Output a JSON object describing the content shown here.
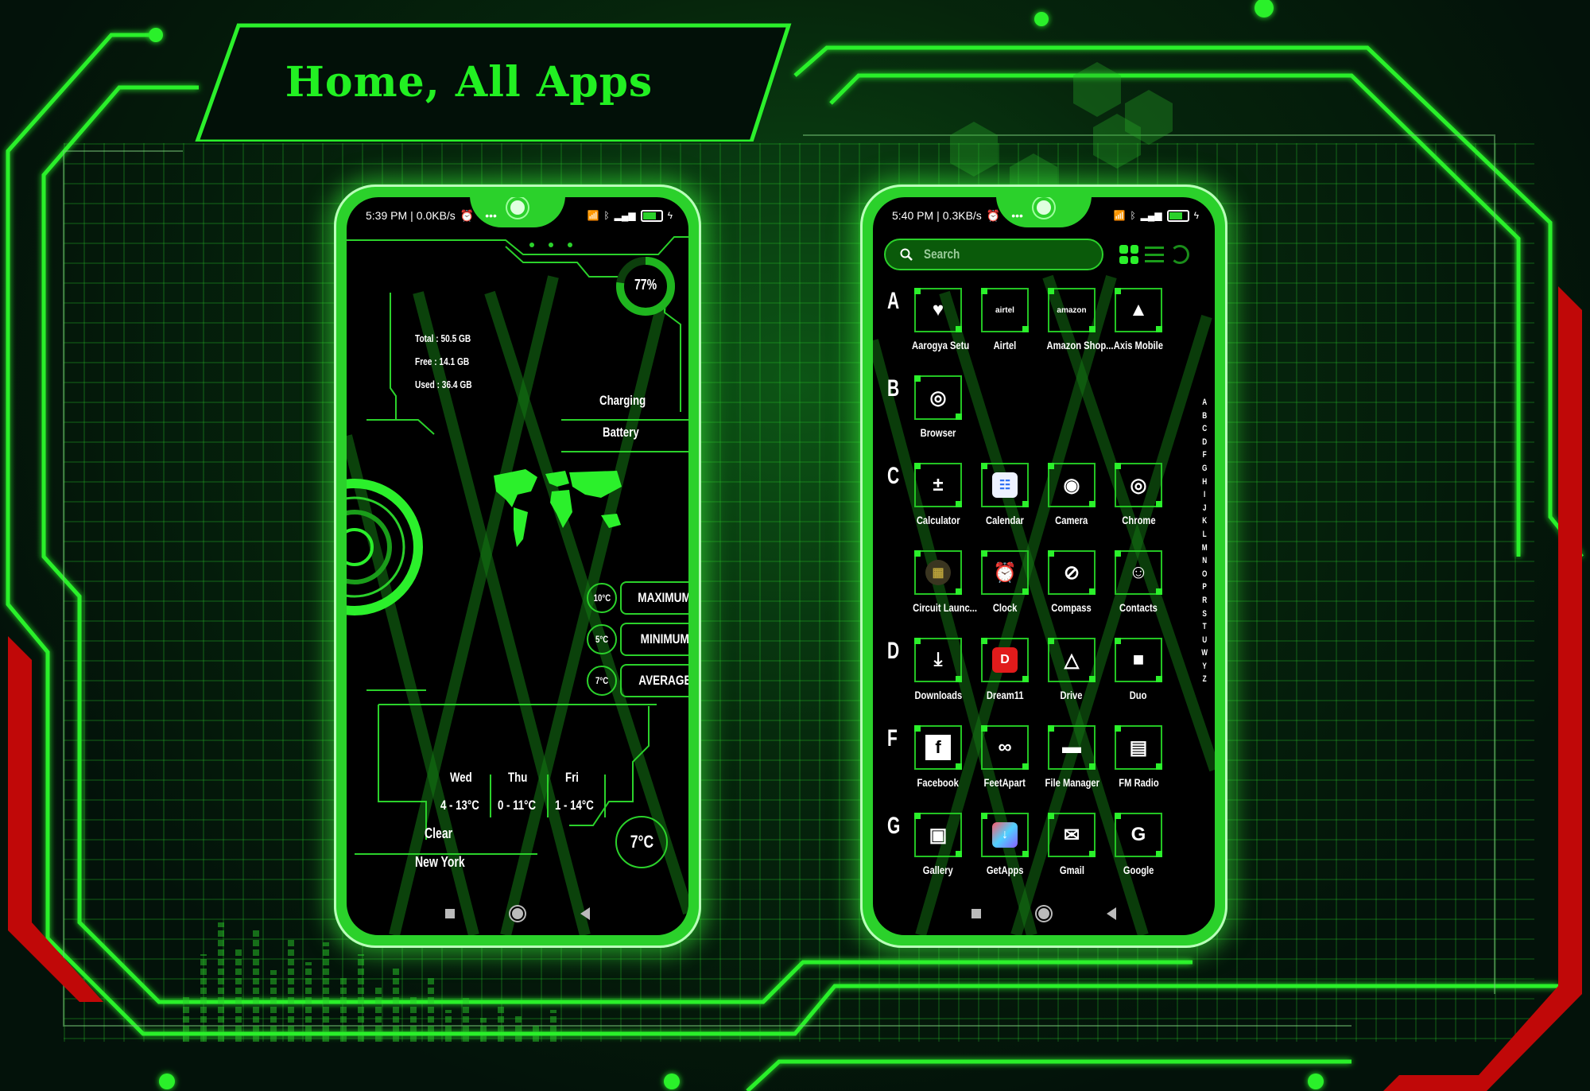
{
  "title": "Home, All Apps",
  "colors": {
    "accent": "#2bf02b",
    "background": "#03120a",
    "warning_stripe": "#d10a0a",
    "dream11_red": "#e11b1b"
  },
  "home_screen": {
    "status_bar": {
      "time": "5:39 PM",
      "net_speed": "0.0KB/s",
      "more": "•••",
      "battery": "77"
    },
    "battery_ring": {
      "percent_label": "77%",
      "value": 0.77
    },
    "storage": {
      "total": "Total : 50.5 GB",
      "free": "Free : 14.1 GB",
      "used": "Used : 36.4 GB"
    },
    "charging_label": "Charging",
    "battery_label": "Battery",
    "temps": [
      {
        "value": "10°C",
        "label": "MAXIMUM"
      },
      {
        "value": "5°C",
        "label": "MINIMUM"
      },
      {
        "value": "7°C",
        "label": "AVERAGE"
      }
    ],
    "forecast": [
      {
        "day": "Wed",
        "range": "4 - 13°C"
      },
      {
        "day": "Thu",
        "range": "0 - 11°C"
      },
      {
        "day": "Fri",
        "range": "1 - 14°C"
      }
    ],
    "condition": "Clear",
    "city": "New York",
    "current_temp": "7°C"
  },
  "drawer_screen": {
    "status_bar": {
      "time": "5:40 PM",
      "net_speed": "0.3KB/s",
      "more": "•••",
      "battery": "77"
    },
    "search_placeholder": "Search",
    "sections": [
      {
        "letter": "A",
        "apps": [
          {
            "name": "Aarogya Setu",
            "icon": "heart-check-icon",
            "glyph": "♥"
          },
          {
            "name": "Airtel",
            "icon": "airtel-icon",
            "glyph": "airtel"
          },
          {
            "name": "Amazon Shop...",
            "icon": "amazon-cart-icon",
            "glyph": "amazon"
          },
          {
            "name": "Axis Mobile",
            "icon": "axis-icon",
            "glyph": "▲"
          }
        ]
      },
      {
        "letter": "B",
        "apps": [
          {
            "name": "Browser",
            "icon": "globe-icon",
            "glyph": "◎"
          }
        ]
      },
      {
        "letter": "C",
        "apps": [
          {
            "name": "Calculator",
            "icon": "calculator-icon",
            "glyph": "±"
          },
          {
            "name": "Calendar",
            "icon": "calendar-icon",
            "glyph": "☷"
          },
          {
            "name": "Camera",
            "icon": "camera-icon",
            "glyph": "◉"
          },
          {
            "name": "Chrome",
            "icon": "chrome-icon",
            "glyph": "◎"
          },
          {
            "name": "Circuit Launc...",
            "icon": "circuit-board-icon",
            "glyph": "▦"
          },
          {
            "name": "Clock",
            "icon": "alarm-clock-icon",
            "glyph": "⏰"
          },
          {
            "name": "Compass",
            "icon": "compass-icon",
            "glyph": "⊘"
          },
          {
            "name": "Contacts",
            "icon": "contact-person-icon",
            "glyph": "☺"
          }
        ]
      },
      {
        "letter": "D",
        "apps": [
          {
            "name": "Downloads",
            "icon": "download-icon",
            "glyph": "⤓"
          },
          {
            "name": "Dream11",
            "icon": "dream11-trophy-icon",
            "glyph": "D"
          },
          {
            "name": "Drive",
            "icon": "drive-triangle-icon",
            "glyph": "△"
          },
          {
            "name": "Duo",
            "icon": "duo-video-icon",
            "glyph": "■"
          }
        ]
      },
      {
        "letter": "F",
        "apps": [
          {
            "name": "Facebook",
            "icon": "facebook-icon",
            "glyph": "f"
          },
          {
            "name": "FeetApart",
            "icon": "feetapart-icon",
            "glyph": "∞"
          },
          {
            "name": "File Manager",
            "icon": "folder-icon",
            "glyph": "▬"
          },
          {
            "name": "FM Radio",
            "icon": "radio-icon",
            "glyph": "▤"
          }
        ]
      },
      {
        "letter": "G",
        "apps": [
          {
            "name": "Gallery",
            "icon": "gallery-image-icon",
            "glyph": "▣"
          },
          {
            "name": "GetApps",
            "icon": "getapps-icon",
            "glyph": "↓"
          },
          {
            "name": "Gmail",
            "icon": "mail-envelope-icon",
            "glyph": "✉"
          },
          {
            "name": "Google",
            "icon": "google-g-icon",
            "glyph": "G"
          }
        ]
      }
    ],
    "alphabet_index": [
      "A",
      "B",
      "C",
      "D",
      "F",
      "G",
      "H",
      "I",
      "J",
      "K",
      "L",
      "M",
      "N",
      "O",
      "P",
      "R",
      "S",
      "T",
      "U",
      "W",
      "Y",
      "Z"
    ]
  }
}
